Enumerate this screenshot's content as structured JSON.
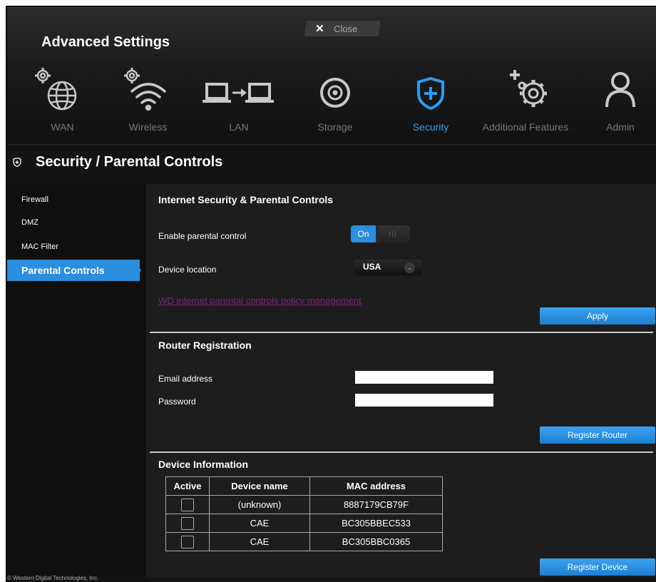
{
  "window": {
    "title": "Advanced Settings",
    "close_label": "Close"
  },
  "nav": [
    {
      "label": "WAN",
      "icon": "globe-gear-icon"
    },
    {
      "label": "Wireless",
      "icon": "wifi-gear-icon"
    },
    {
      "label": "LAN",
      "icon": "lan-computers-icon"
    },
    {
      "label": "Storage",
      "icon": "disk-icon"
    },
    {
      "label": "Security",
      "icon": "shield-plus-icon",
      "active": true
    },
    {
      "label": "Additional Features",
      "icon": "gears-plus-icon"
    },
    {
      "label": "Admin",
      "icon": "user-icon"
    }
  ],
  "section_title": "Security / Parental Controls",
  "sidebar": [
    {
      "label": "Firewall"
    },
    {
      "label": "DMZ"
    },
    {
      "label": "MAC Filter"
    },
    {
      "label": "Parental Controls",
      "active": true
    }
  ],
  "parental": {
    "heading": "Internet Security & Parental Controls",
    "enable_label": "Enable parental control",
    "toggle_on_label": "On",
    "location_label": "Device location",
    "location_value": "USA",
    "policy_link": "WD internet parental controls policy management",
    "apply_label": "Apply"
  },
  "registration": {
    "heading": "Router Registration",
    "email_label": "Email address",
    "email_value": "",
    "password_label": "Password",
    "password_value": "",
    "register_label": "Register Router"
  },
  "devices": {
    "heading": "Device Information",
    "columns": [
      "Active",
      "Device name",
      "MAC address"
    ],
    "rows": [
      {
        "name": "(unknown)",
        "mac": "8887179CB79F"
      },
      {
        "name": "CAE",
        "mac": "BC305BBEC533"
      },
      {
        "name": "CAE",
        "mac": "BC305BBC0365"
      }
    ],
    "register_label": "Register Device"
  },
  "footer": {
    "copyright": "© Western Digital Technologies, Inc."
  },
  "colors": {
    "accent": "#2b8fe0",
    "link": "#80207a",
    "background": "#1d1d1d"
  }
}
